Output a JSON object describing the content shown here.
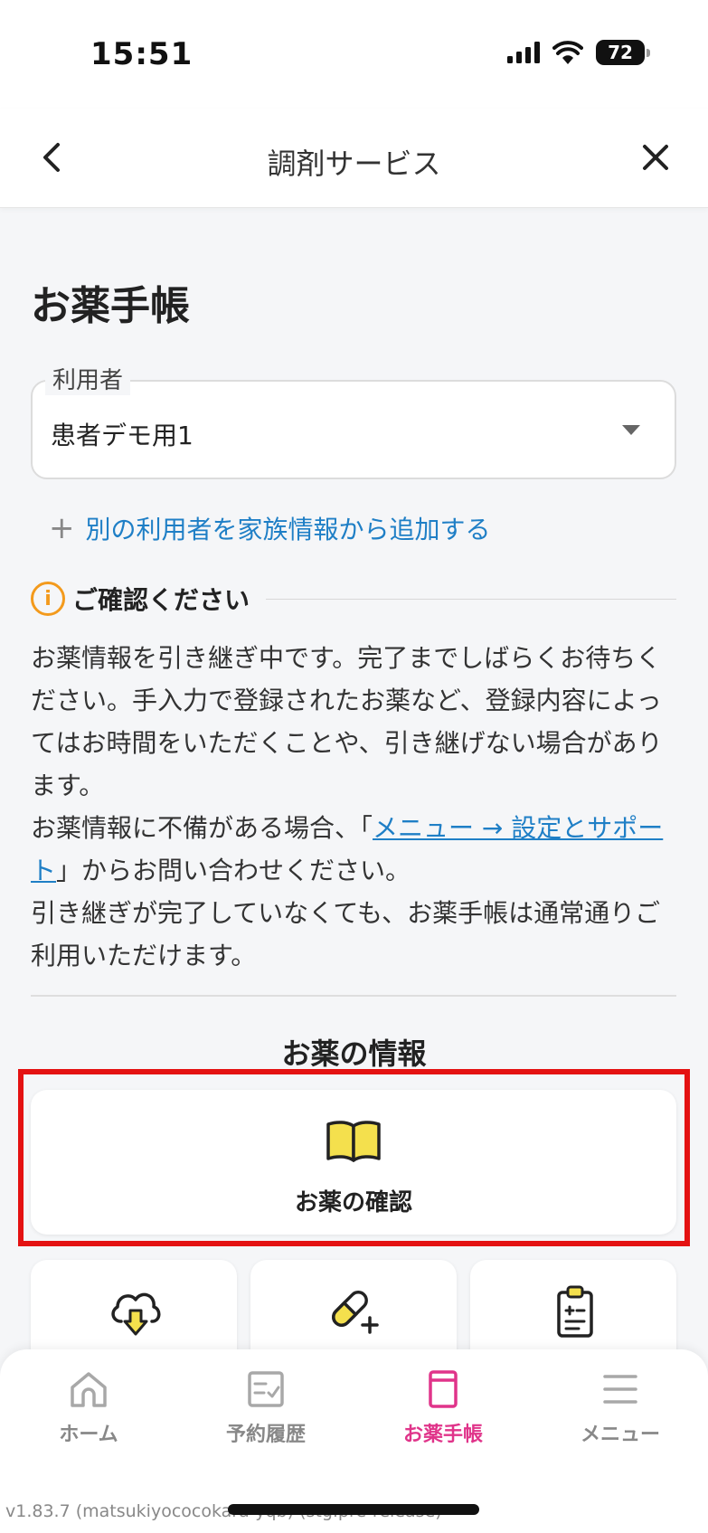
{
  "status_bar": {
    "time": "15:51",
    "battery": "72"
  },
  "nav": {
    "title": "調剤サービス"
  },
  "page": {
    "title": "お薬手帳"
  },
  "user_select": {
    "legend": "利用者",
    "value": "患者デモ用1"
  },
  "add_user": {
    "label": "別の利用者を家族情報から追加する"
  },
  "notice": {
    "title": "ご確認ください",
    "p1": "お薬情報を引き継ぎ中です。完了までしばらくお待ちください。手入力で登録されたお薬など、登録内容によってはお時間をいただくことや、引き継げない場合があります。",
    "p2_prefix": "お薬情報に不備がある場合、「",
    "p2_link": "メニュー → 設定とサポート",
    "p2_suffix": "」からお問い合わせください。",
    "p3": "引き継ぎが完了していなくても、お薬手帳は通常通りご利用いただけます。"
  },
  "medicine_section": {
    "title": "お薬の情報",
    "main_card_label": "お薬の確認"
  },
  "tabbar": {
    "tabs": [
      {
        "label": "ホーム"
      },
      {
        "label": "予約履歴"
      },
      {
        "label": "お薬手帳"
      },
      {
        "label": "メニュー"
      }
    ]
  },
  "footer": {
    "version": "v1.83.7 (matsukiyococokara-yqb) (stg.pre-release)"
  },
  "colors": {
    "accent": "#e0348a",
    "link": "#1f7fc6",
    "highlight": "#e41212",
    "info": "#f39a1c",
    "icon_fill": "#f4e04d"
  }
}
